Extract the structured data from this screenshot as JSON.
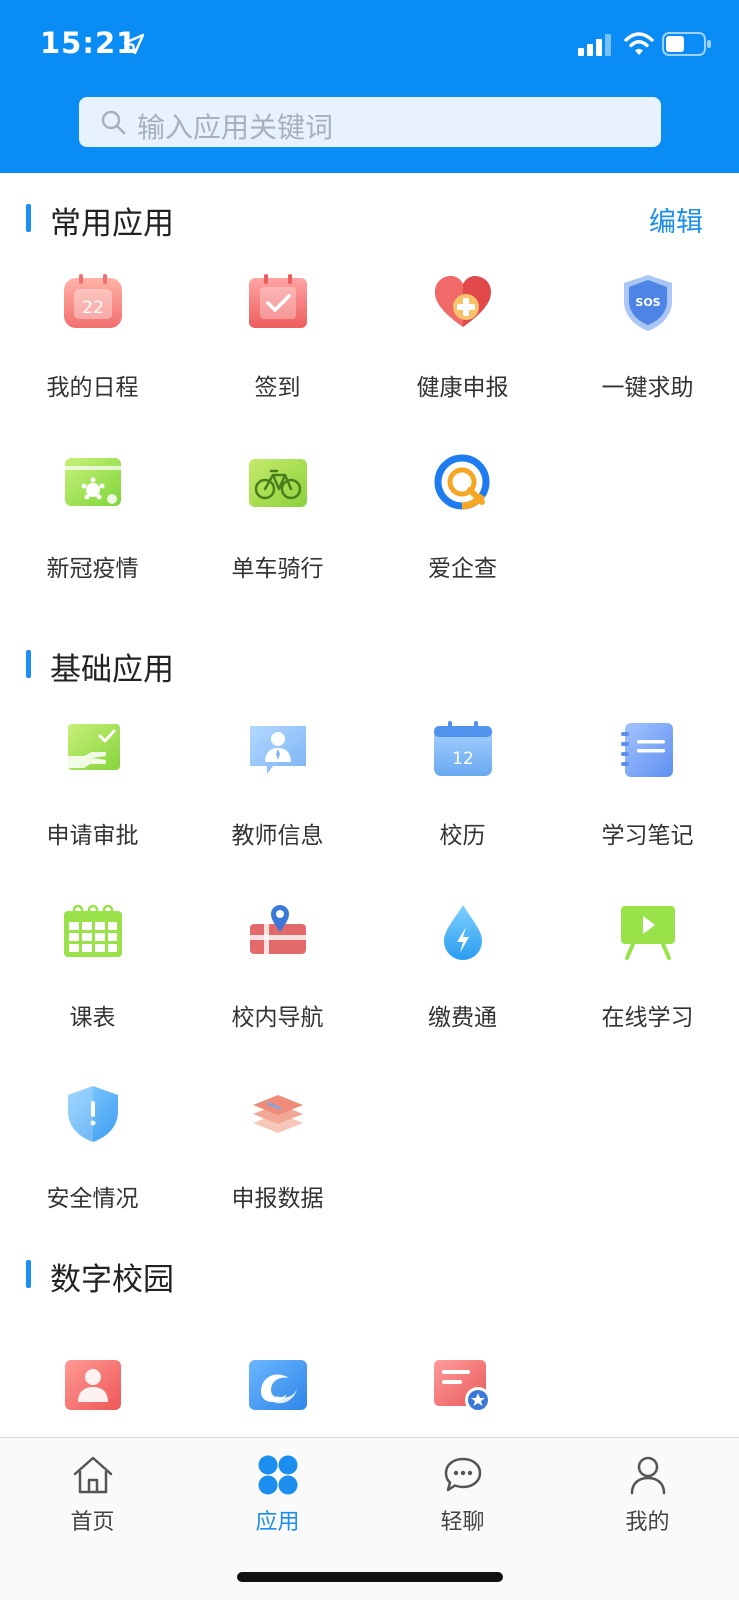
{
  "status": {
    "time": "15:21"
  },
  "search": {
    "placeholder": "输入应用关键词"
  },
  "sections": {
    "common": {
      "title": "常用应用",
      "edit": "编辑"
    },
    "basic": {
      "title": "基础应用"
    },
    "digital": {
      "title": "数字校园"
    }
  },
  "apps": {
    "common": [
      {
        "label": "我的日程",
        "icon": "calendar-icon",
        "day": "22"
      },
      {
        "label": "签到",
        "icon": "checkin-icon"
      },
      {
        "label": "健康申报",
        "icon": "health-heart-icon"
      },
      {
        "label": "一键求助",
        "icon": "sos-shield-icon",
        "badge": "SOS"
      },
      {
        "label": "新冠疫情",
        "icon": "virus-icon"
      },
      {
        "label": "单车骑行",
        "icon": "bicycle-icon"
      },
      {
        "label": "爱企查",
        "icon": "aiqicha-icon"
      }
    ],
    "basic": [
      {
        "label": "申请审批",
        "icon": "approval-icon"
      },
      {
        "label": "教师信息",
        "icon": "teacher-icon"
      },
      {
        "label": "校历",
        "icon": "school-calendar-icon",
        "day": "12"
      },
      {
        "label": "学习笔记",
        "icon": "notebook-icon"
      },
      {
        "label": "课表",
        "icon": "timetable-icon"
      },
      {
        "label": "校内导航",
        "icon": "campus-map-icon"
      },
      {
        "label": "缴费通",
        "icon": "payment-drop-icon"
      },
      {
        "label": "在线学习",
        "icon": "online-video-icon"
      },
      {
        "label": "安全情况",
        "icon": "safety-shield-icon"
      },
      {
        "label": "申报数据",
        "icon": "layers-icon"
      }
    ],
    "digital": [
      {
        "icon": "contacts-icon"
      },
      {
        "icon": "campus-logo-icon"
      },
      {
        "icon": "certificate-icon"
      }
    ]
  },
  "tabs": [
    {
      "label": "首页",
      "icon": "home-icon"
    },
    {
      "label": "应用",
      "icon": "apps-icon",
      "active": true
    },
    {
      "label": "轻聊",
      "icon": "chat-icon"
    },
    {
      "label": "我的",
      "icon": "profile-icon"
    }
  ],
  "colors": {
    "header": "#0a8cf5",
    "accent": "#1b8ef0"
  }
}
